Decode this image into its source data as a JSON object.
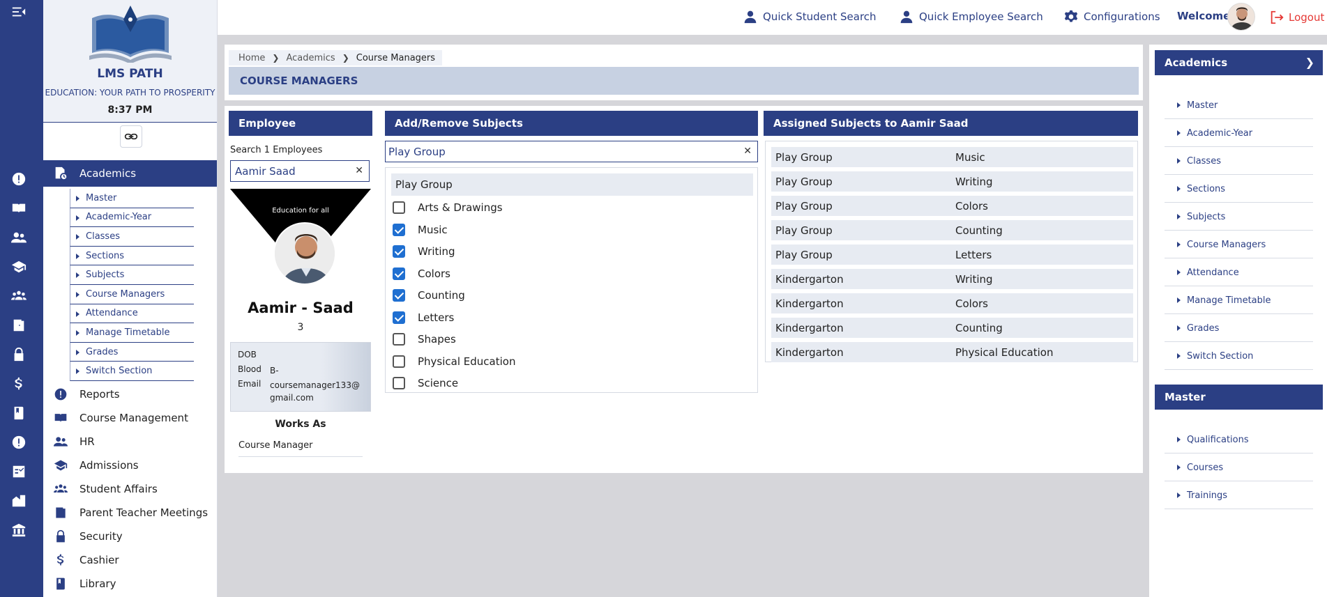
{
  "topbar": {
    "quick_student": "Quick Student Search",
    "quick_employee": "Quick Employee Search",
    "configurations": "Configurations",
    "welcome": "Welcome",
    "logout": "Logout"
  },
  "brand": {
    "name": "LMS PATH",
    "tagline": "EDUCATION: YOUR PATH TO PROSPERITY",
    "time": "8:37 PM"
  },
  "sidebar": {
    "active_section": "Academics",
    "submenu": [
      "Master",
      "Academic-Year",
      "Classes",
      "Sections",
      "Subjects",
      "Course Managers",
      "Attendance",
      "Manage Timetable",
      "Grades",
      "Switch Section"
    ],
    "menu": [
      {
        "label": "Reports",
        "icon": "alert-icon"
      },
      {
        "label": "Course Management",
        "icon": "book-open-icon"
      },
      {
        "label": "HR",
        "icon": "people-icon"
      },
      {
        "label": "Admissions",
        "icon": "graduation-cap-icon"
      },
      {
        "label": "Student Affairs",
        "icon": "group-icon"
      },
      {
        "label": "Parent Teacher Meetings",
        "icon": "door-icon"
      },
      {
        "label": "Security",
        "icon": "lock-icon"
      },
      {
        "label": "Cashier",
        "icon": "dollar-icon"
      },
      {
        "label": "Library",
        "icon": "book-icon"
      }
    ]
  },
  "breadcrumb": {
    "home": "Home",
    "academics": "Academics",
    "current": "Course Managers"
  },
  "page_title": "COURSE MANAGERS",
  "employee": {
    "header": "Employee",
    "search_label": "Search 1 Employees",
    "search_value": "Aamir Saad",
    "banner": "Education for all",
    "name": "Aamir - Saad",
    "id": "3",
    "dob_label": "DOB",
    "dob": "",
    "blood_label": "Blood",
    "blood": "B-",
    "email_label": "Email",
    "email": "coursemanager133@ gmail.com",
    "works_as_label": "Works As",
    "role": "Course Manager"
  },
  "add_remove": {
    "header": "Add/Remove Subjects",
    "selected_class": "Play Group",
    "group_header": "Play Group",
    "subjects": [
      {
        "label": "Arts & Drawings",
        "checked": false
      },
      {
        "label": "Music",
        "checked": true
      },
      {
        "label": "Writing",
        "checked": true
      },
      {
        "label": "Colors",
        "checked": true
      },
      {
        "label": "Counting",
        "checked": true
      },
      {
        "label": "Letters",
        "checked": true
      },
      {
        "label": "Shapes",
        "checked": false
      },
      {
        "label": "Physical Education",
        "checked": false
      },
      {
        "label": "Science",
        "checked": false
      }
    ]
  },
  "assigned": {
    "header": "Assigned Subjects to Aamir Saad",
    "rows": [
      [
        "Play Group",
        "Music"
      ],
      [
        "Play Group",
        "Writing"
      ],
      [
        "Play Group",
        "Colors"
      ],
      [
        "Play Group",
        "Counting"
      ],
      [
        "Play Group",
        "Letters"
      ],
      [
        "Kindergarton",
        "Writing"
      ],
      [
        "Kindergarton",
        "Colors"
      ],
      [
        "Kindergarton",
        "Counting"
      ],
      [
        "Kindergarton",
        "Physical Education"
      ]
    ]
  },
  "right_panel": {
    "academics_header": "Academics",
    "academics_items": [
      "Master",
      "Academic-Year",
      "Classes",
      "Sections",
      "Subjects",
      "Course Managers",
      "Attendance",
      "Manage Timetable",
      "Grades",
      "Switch Section"
    ],
    "master_header": "Master",
    "master_items": [
      "Qualifications",
      "Courses",
      "Trainings"
    ]
  },
  "colors": {
    "primary": "#2b3f84",
    "logout": "#e53935",
    "checkbox": "#1f6fd1"
  }
}
